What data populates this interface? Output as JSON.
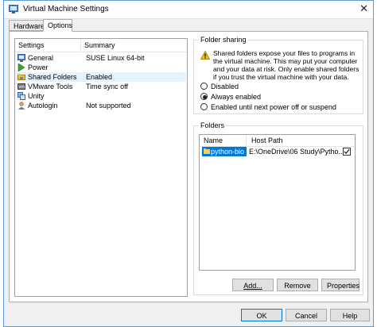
{
  "window": {
    "title": "Virtual Machine Settings"
  },
  "tabs": [
    {
      "label": "Hardware",
      "active": false
    },
    {
      "label": "Options",
      "active": true
    }
  ],
  "settings_list": {
    "columns": [
      "Settings",
      "Summary"
    ],
    "rows": [
      {
        "name": "General",
        "summary": "SUSE Linux 64-bit",
        "icon": "general-icon",
        "selected": false
      },
      {
        "name": "Power",
        "summary": "",
        "icon": "power-icon",
        "selected": false
      },
      {
        "name": "Shared Folders",
        "summary": "Enabled",
        "icon": "shared-folders-icon",
        "selected": true
      },
      {
        "name": "VMware Tools",
        "summary": "Time sync off",
        "icon": "vmware-tools-icon",
        "selected": false
      },
      {
        "name": "Unity",
        "summary": "",
        "icon": "unity-icon",
        "selected": false
      },
      {
        "name": "Autologin",
        "summary": "Not supported",
        "icon": "autologin-icon",
        "selected": false
      }
    ]
  },
  "folder_sharing": {
    "label": "Folder sharing",
    "warning": "Shared folders expose your files to programs in the virtual machine. This may put your computer and your data at risk. Only enable shared folders if you trust the virtual machine with your data.",
    "options": [
      {
        "label": "Disabled",
        "selected": false
      },
      {
        "label": "Always enabled",
        "selected": true
      },
      {
        "label": "Enabled until next power off or suspend",
        "selected": false
      }
    ]
  },
  "folders": {
    "label": "Folders",
    "columns": [
      "Name",
      "Host Path"
    ],
    "rows": [
      {
        "name": "python-bio",
        "host_path": "E:\\OneDrive\\06 Study\\Pytho...",
        "checked": true
      }
    ],
    "buttons": {
      "add": "Add...",
      "remove": "Remove",
      "properties": "Properties"
    }
  },
  "footer": {
    "ok": "OK",
    "cancel": "Cancel",
    "help": "Help"
  },
  "colors": {
    "selection": "#0078d7",
    "border": "#5a9bd6",
    "warning": "#f2c200"
  }
}
